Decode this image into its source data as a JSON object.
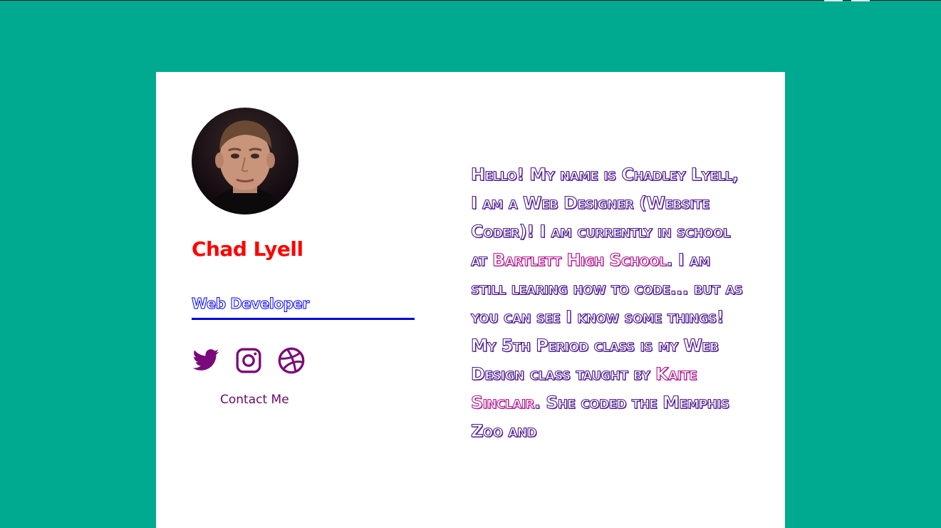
{
  "profile": {
    "name": "Chad Lyell",
    "role": "Web Developer",
    "avatar_alt": "Profile photo"
  },
  "social": [
    {
      "icon": "twitter-icon",
      "color": "#7a0a7a"
    },
    {
      "icon": "instagram-icon",
      "color": "#7a0a7a"
    },
    {
      "icon": "dribbble-icon",
      "color": "#7a0a7a"
    }
  ],
  "contact_label": "Contact Me",
  "bio": {
    "p1": "Hello! My name is Chadley Lyell, I am a Web Designer (Website Coder)! I am currently in school at ",
    "school": "Bartlett High School",
    "p2": ". I am still learing how to code... but as you can see I know some things! My 5th Period class is my Web Design class taught by ",
    "teacher": "Kaite Sinclair",
    "p3": ". She coded the Memphis Zoo and"
  },
  "colors": {
    "background": "#00aa90",
    "card": "#ffffff",
    "name": "#ff0000",
    "role_underline": "#0000dd",
    "social": "#7a0a7a",
    "bio_text": "#4b1a8c",
    "bio_highlight": "#b01a8c"
  }
}
